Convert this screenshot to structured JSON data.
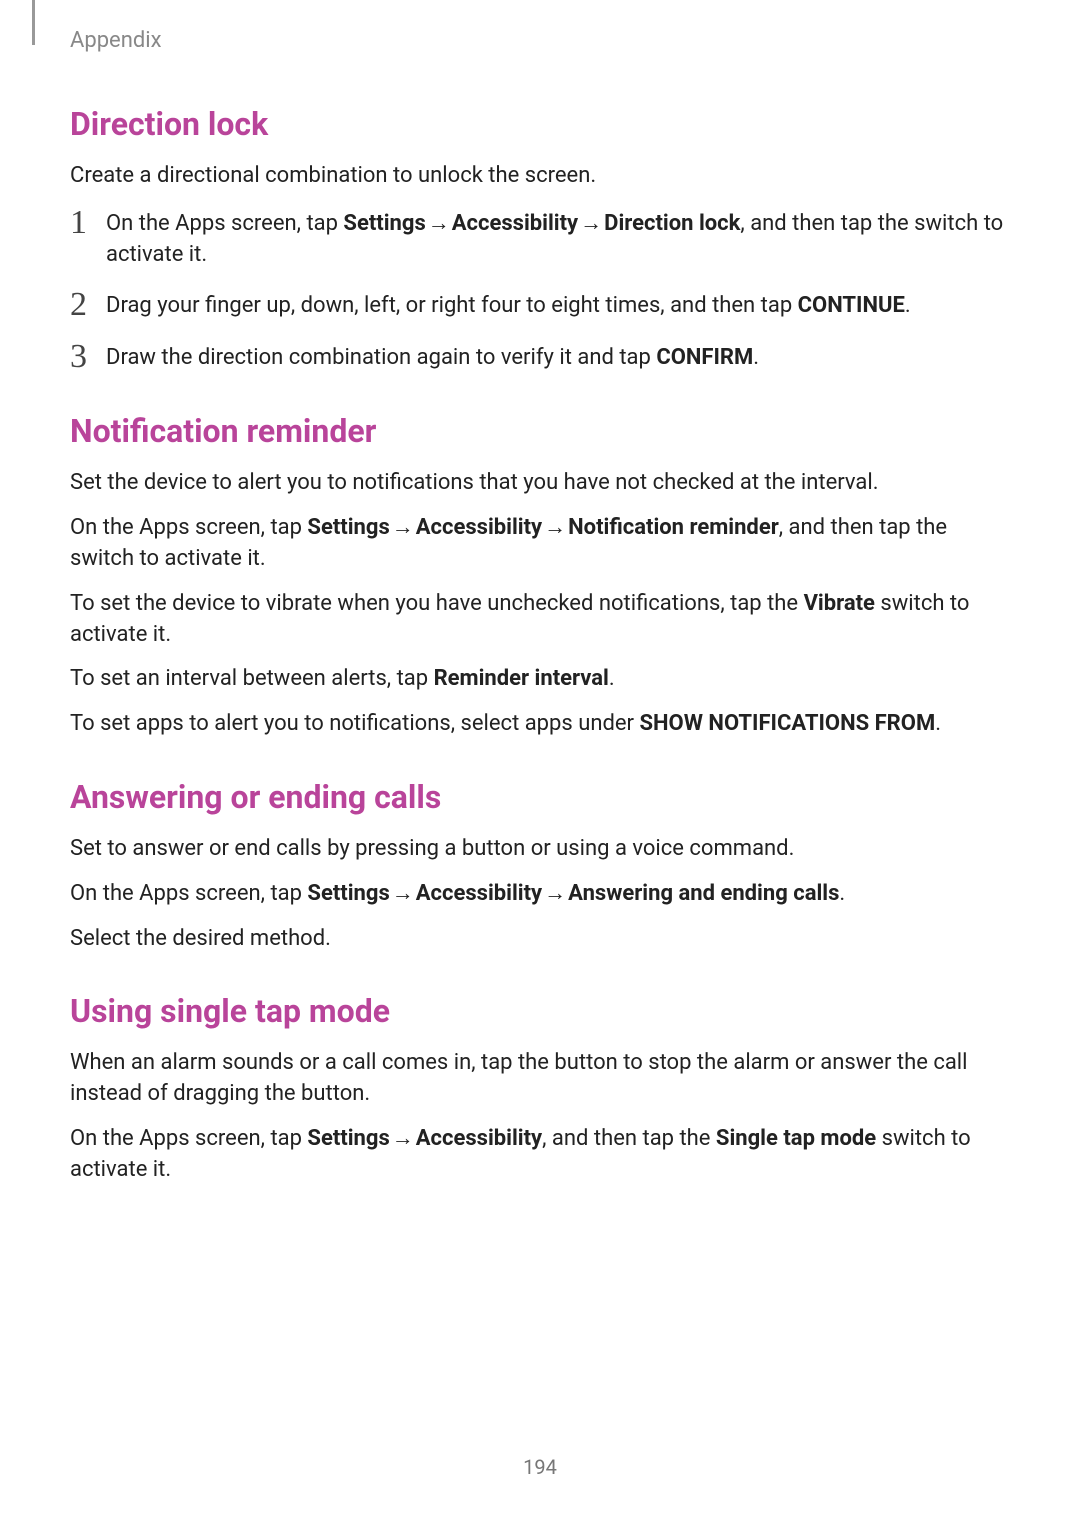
{
  "header": {
    "section": "Appendix"
  },
  "page_number": "194",
  "arrow": "→",
  "s1": {
    "title": "Direction lock",
    "intro": "Create a directional combination to unlock the screen.",
    "steps": [
      {
        "num": "1",
        "pre": "On the Apps screen, tap ",
        "path": [
          "Settings",
          "Accessibility",
          "Direction lock"
        ],
        "post": ", and then tap the switch to activate it."
      },
      {
        "num": "2",
        "pre": "Drag your finger up, down, left, or right four to eight times, and then tap ",
        "bold": "CONTINUE",
        "post": "."
      },
      {
        "num": "3",
        "pre": "Draw the direction combination again to verify it and tap ",
        "bold": "CONFIRM",
        "post": "."
      }
    ]
  },
  "s2": {
    "title": "Notification reminder",
    "p1": "Set the device to alert you to notifications that you have not checked at the interval.",
    "p2_pre": "On the Apps screen, tap ",
    "p2_path": [
      "Settings",
      "Accessibility",
      "Notification reminder"
    ],
    "p2_post": ", and then tap the switch to activate it.",
    "p3_pre": "To set the device to vibrate when you have unchecked notifications, tap the ",
    "p3_bold": "Vibrate",
    "p3_post": " switch to activate it.",
    "p4_pre": "To set an interval between alerts, tap ",
    "p4_bold": "Reminder interval",
    "p4_post": ".",
    "p5_pre": "To set apps to alert you to notifications, select apps under ",
    "p5_bold": "SHOW NOTIFICATIONS FROM",
    "p5_post": "."
  },
  "s3": {
    "title": "Answering or ending calls",
    "p1": "Set to answer or end calls by pressing a button or using a voice command.",
    "p2_pre": "On the Apps screen, tap ",
    "p2_path": [
      "Settings",
      "Accessibility",
      "Answering and ending calls"
    ],
    "p2_post": ".",
    "p3": "Select the desired method."
  },
  "s4": {
    "title": "Using single tap mode",
    "p1": "When an alarm sounds or a call comes in, tap the button to stop the alarm or answer the call instead of dragging the button.",
    "p2_pre": "On the Apps screen, tap ",
    "p2_path": [
      "Settings",
      "Accessibility"
    ],
    "p2_mid": ", and then tap the ",
    "p2_bold": "Single tap mode",
    "p2_post": " switch to activate it."
  }
}
